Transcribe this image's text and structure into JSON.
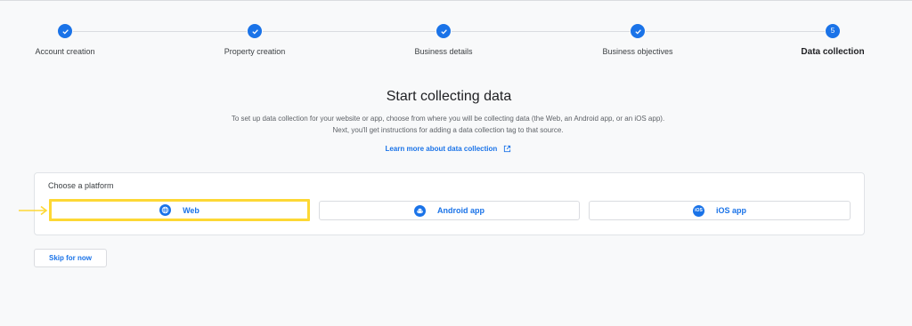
{
  "stepper": {
    "steps": [
      {
        "label": "Account creation",
        "state": "complete",
        "marker": "check-icon"
      },
      {
        "label": "Property creation",
        "state": "complete",
        "marker": "check-icon"
      },
      {
        "label": "Business details",
        "state": "complete",
        "marker": "check-icon"
      },
      {
        "label": "Business objectives",
        "state": "complete",
        "marker": "check-icon"
      },
      {
        "label": "Data collection",
        "state": "current",
        "number": "5"
      }
    ]
  },
  "main": {
    "heading": "Start collecting data",
    "description": "To set up data collection for your website or app, choose from where you will be collecting data (the Web, an Android app, or an iOS app). Next, you'll get instructions for adding a data collection tag to that source.",
    "learn_more": "Learn more about data collection",
    "learn_more_icon": "open-in-new-icon"
  },
  "platform": {
    "title": "Choose a platform",
    "options": [
      {
        "label": "Web",
        "icon": "globe-icon",
        "highlighted": true
      },
      {
        "label": "Android app",
        "icon": "android-icon",
        "highlighted": false
      },
      {
        "label": "iOS app",
        "icon": "ios-icon",
        "icon_text": "iOS",
        "highlighted": false
      }
    ]
  },
  "footer": {
    "skip_label": "Skip for now"
  },
  "colors": {
    "accent": "#1a73e8",
    "highlight": "#fdd835",
    "background": "#f8f9fa"
  }
}
